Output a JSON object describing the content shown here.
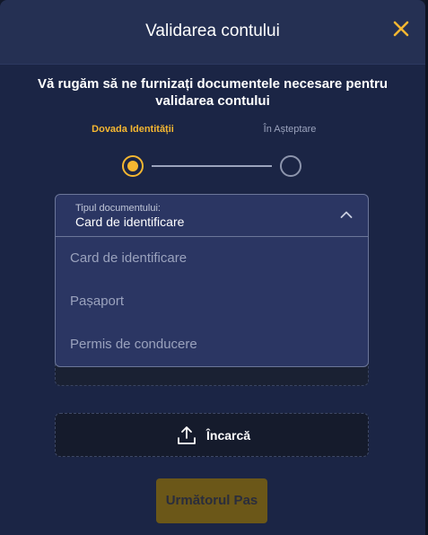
{
  "header": {
    "title": "Validarea contului",
    "close_icon": "close-x-icon"
  },
  "intro_text": "Vă rugăm să ne furnizați documentele necesare pentru validarea contului",
  "steps": [
    {
      "label": "Dovada Identității",
      "state": "active"
    },
    {
      "label": "În Așteptare",
      "state": "pending"
    }
  ],
  "document_select": {
    "caption": "Tipul documentului:",
    "value": "Card de identificare",
    "expanded": true,
    "options": [
      "Card de identificare",
      "Pașaport",
      "Permis de conducere"
    ]
  },
  "upload": {
    "label": "Încarcă",
    "icon": "upload-icon"
  },
  "next_button": {
    "label": "Următorul Pas",
    "enabled": false
  },
  "colors": {
    "accent": "#f5b731",
    "background": "#1b2545",
    "header": "#253053",
    "dropdown": "#2b3663"
  }
}
